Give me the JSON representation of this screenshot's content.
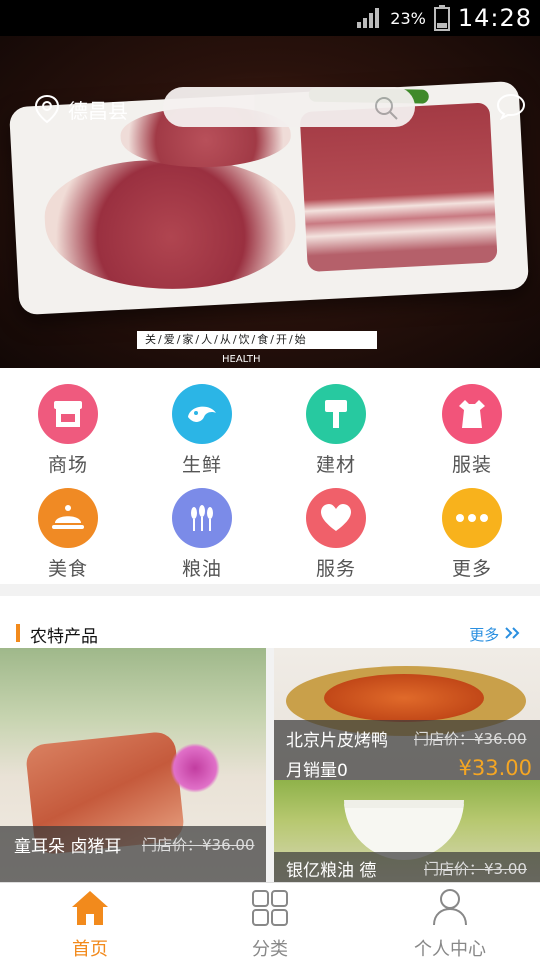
{
  "status_bar": {
    "battery_percent": "23%",
    "time": "14:28"
  },
  "header": {
    "location": "德昌县",
    "search_placeholder": ""
  },
  "banner": {
    "slogan": "关/爱/家/人/从/饮/食/开/始",
    "health_text": "HEALTH",
    "active_slide": 1,
    "slide_count": 5
  },
  "categories": [
    {
      "label": "商场",
      "icon": "store-icon",
      "color": "#ef5a7e"
    },
    {
      "label": "生鲜",
      "icon": "shrimp-icon",
      "color": "#2bb5e6"
    },
    {
      "label": "建材",
      "icon": "paintbrush-icon",
      "color": "#27c9a0"
    },
    {
      "label": "服装",
      "icon": "dress-icon",
      "color": "#f2547a"
    },
    {
      "label": "美食",
      "icon": "food-cover-icon",
      "color": "#f08a24"
    },
    {
      "label": "粮油",
      "icon": "grain-icon",
      "color": "#7b8be8"
    },
    {
      "label": "服务",
      "icon": "heart-icon",
      "color": "#f0606a"
    },
    {
      "label": "更多",
      "icon": "more-icon",
      "color": "#f8b21c"
    }
  ],
  "section": {
    "title": "农特产品",
    "more": "更多"
  },
  "products": [
    {
      "name": "童耳朵 卤猪耳",
      "orig_price": "门店价：¥36.00"
    },
    {
      "name": "北京片皮烤鸭",
      "orig_price": "门店价：¥36.00",
      "monthly_sales": "月销量0",
      "price": "¥33.00"
    },
    {
      "name": "银亿粮油  德",
      "orig_price": "门店价：¥3.00"
    }
  ],
  "tabs": [
    {
      "label": "首页",
      "icon": "home-icon",
      "active": true
    },
    {
      "label": "分类",
      "icon": "grid-icon",
      "active": false
    },
    {
      "label": "个人中心",
      "icon": "user-icon",
      "active": false
    }
  ],
  "colors": {
    "accent": "#f28a1c",
    "link": "#2a8fe0",
    "price": "#f5a623"
  }
}
